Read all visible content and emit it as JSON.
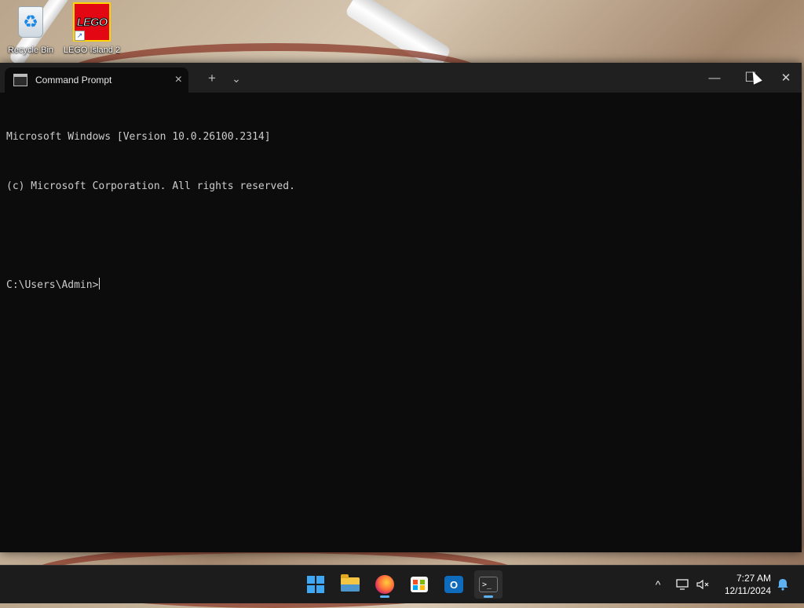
{
  "desktop": {
    "icons": [
      {
        "label": "Recycle Bin"
      },
      {
        "label": "LEGO Island 2",
        "logo_text": "LEGO"
      }
    ]
  },
  "window": {
    "tab_title": "Command Prompt",
    "tab_close": "×",
    "new_tab": "+",
    "dropdown": "⌄",
    "minimize": "—",
    "maximize": "☐",
    "close": "✕"
  },
  "console": {
    "lines": [
      "Microsoft Windows [Version 10.0.26100.2314]",
      "(c) Microsoft Corporation. All rights reserved.",
      "",
      "C:\\Users\\Admin>"
    ]
  },
  "taskbar": {
    "apps": [
      {
        "name": "start"
      },
      {
        "name": "file-explorer"
      },
      {
        "name": "firefox"
      },
      {
        "name": "microsoft-store"
      },
      {
        "name": "outlook-new",
        "glyph": "O"
      },
      {
        "name": "terminal",
        "glyph": ">_"
      }
    ],
    "tray": {
      "chevron": "^",
      "time": "7:27 AM",
      "date": "12/11/2024"
    }
  },
  "colors": {
    "console_bg": "#0c0c0c",
    "titlebar_bg": "#202020",
    "taskbar_bg": "#1c1c1c",
    "accent": "#5fb2f2"
  }
}
